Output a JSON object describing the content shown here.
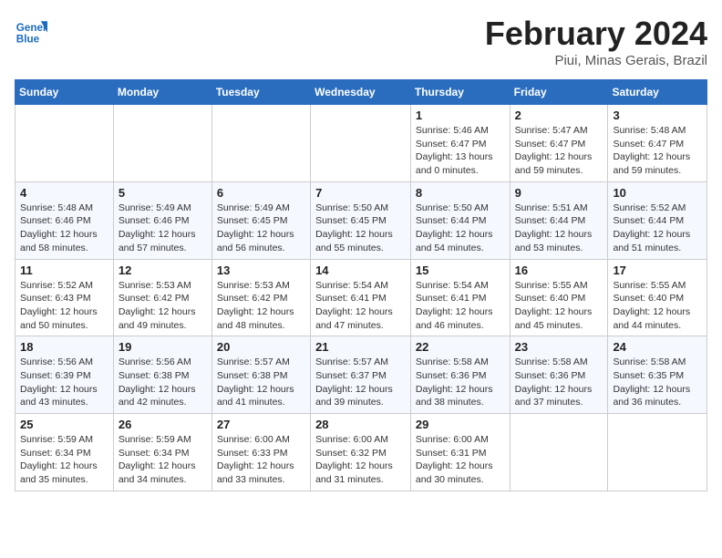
{
  "header": {
    "logo_line1": "General",
    "logo_line2": "Blue",
    "main_title": "February 2024",
    "subtitle": "Piui, Minas Gerais, Brazil"
  },
  "weekdays": [
    "Sunday",
    "Monday",
    "Tuesday",
    "Wednesday",
    "Thursday",
    "Friday",
    "Saturday"
  ],
  "weeks": [
    [
      {
        "day": "",
        "info": ""
      },
      {
        "day": "",
        "info": ""
      },
      {
        "day": "",
        "info": ""
      },
      {
        "day": "",
        "info": ""
      },
      {
        "day": "1",
        "info": "Sunrise: 5:46 AM\nSunset: 6:47 PM\nDaylight: 13 hours\nand 0 minutes."
      },
      {
        "day": "2",
        "info": "Sunrise: 5:47 AM\nSunset: 6:47 PM\nDaylight: 12 hours\nand 59 minutes."
      },
      {
        "day": "3",
        "info": "Sunrise: 5:48 AM\nSunset: 6:47 PM\nDaylight: 12 hours\nand 59 minutes."
      }
    ],
    [
      {
        "day": "4",
        "info": "Sunrise: 5:48 AM\nSunset: 6:46 PM\nDaylight: 12 hours\nand 58 minutes."
      },
      {
        "day": "5",
        "info": "Sunrise: 5:49 AM\nSunset: 6:46 PM\nDaylight: 12 hours\nand 57 minutes."
      },
      {
        "day": "6",
        "info": "Sunrise: 5:49 AM\nSunset: 6:45 PM\nDaylight: 12 hours\nand 56 minutes."
      },
      {
        "day": "7",
        "info": "Sunrise: 5:50 AM\nSunset: 6:45 PM\nDaylight: 12 hours\nand 55 minutes."
      },
      {
        "day": "8",
        "info": "Sunrise: 5:50 AM\nSunset: 6:44 PM\nDaylight: 12 hours\nand 54 minutes."
      },
      {
        "day": "9",
        "info": "Sunrise: 5:51 AM\nSunset: 6:44 PM\nDaylight: 12 hours\nand 53 minutes."
      },
      {
        "day": "10",
        "info": "Sunrise: 5:52 AM\nSunset: 6:44 PM\nDaylight: 12 hours\nand 51 minutes."
      }
    ],
    [
      {
        "day": "11",
        "info": "Sunrise: 5:52 AM\nSunset: 6:43 PM\nDaylight: 12 hours\nand 50 minutes."
      },
      {
        "day": "12",
        "info": "Sunrise: 5:53 AM\nSunset: 6:42 PM\nDaylight: 12 hours\nand 49 minutes."
      },
      {
        "day": "13",
        "info": "Sunrise: 5:53 AM\nSunset: 6:42 PM\nDaylight: 12 hours\nand 48 minutes."
      },
      {
        "day": "14",
        "info": "Sunrise: 5:54 AM\nSunset: 6:41 PM\nDaylight: 12 hours\nand 47 minutes."
      },
      {
        "day": "15",
        "info": "Sunrise: 5:54 AM\nSunset: 6:41 PM\nDaylight: 12 hours\nand 46 minutes."
      },
      {
        "day": "16",
        "info": "Sunrise: 5:55 AM\nSunset: 6:40 PM\nDaylight: 12 hours\nand 45 minutes."
      },
      {
        "day": "17",
        "info": "Sunrise: 5:55 AM\nSunset: 6:40 PM\nDaylight: 12 hours\nand 44 minutes."
      }
    ],
    [
      {
        "day": "18",
        "info": "Sunrise: 5:56 AM\nSunset: 6:39 PM\nDaylight: 12 hours\nand 43 minutes."
      },
      {
        "day": "19",
        "info": "Sunrise: 5:56 AM\nSunset: 6:38 PM\nDaylight: 12 hours\nand 42 minutes."
      },
      {
        "day": "20",
        "info": "Sunrise: 5:57 AM\nSunset: 6:38 PM\nDaylight: 12 hours\nand 41 minutes."
      },
      {
        "day": "21",
        "info": "Sunrise: 5:57 AM\nSunset: 6:37 PM\nDaylight: 12 hours\nand 39 minutes."
      },
      {
        "day": "22",
        "info": "Sunrise: 5:58 AM\nSunset: 6:36 PM\nDaylight: 12 hours\nand 38 minutes."
      },
      {
        "day": "23",
        "info": "Sunrise: 5:58 AM\nSunset: 6:36 PM\nDaylight: 12 hours\nand 37 minutes."
      },
      {
        "day": "24",
        "info": "Sunrise: 5:58 AM\nSunset: 6:35 PM\nDaylight: 12 hours\nand 36 minutes."
      }
    ],
    [
      {
        "day": "25",
        "info": "Sunrise: 5:59 AM\nSunset: 6:34 PM\nDaylight: 12 hours\nand 35 minutes."
      },
      {
        "day": "26",
        "info": "Sunrise: 5:59 AM\nSunset: 6:34 PM\nDaylight: 12 hours\nand 34 minutes."
      },
      {
        "day": "27",
        "info": "Sunrise: 6:00 AM\nSunset: 6:33 PM\nDaylight: 12 hours\nand 33 minutes."
      },
      {
        "day": "28",
        "info": "Sunrise: 6:00 AM\nSunset: 6:32 PM\nDaylight: 12 hours\nand 31 minutes."
      },
      {
        "day": "29",
        "info": "Sunrise: 6:00 AM\nSunset: 6:31 PM\nDaylight: 12 hours\nand 30 minutes."
      },
      {
        "day": "",
        "info": ""
      },
      {
        "day": "",
        "info": ""
      }
    ]
  ]
}
